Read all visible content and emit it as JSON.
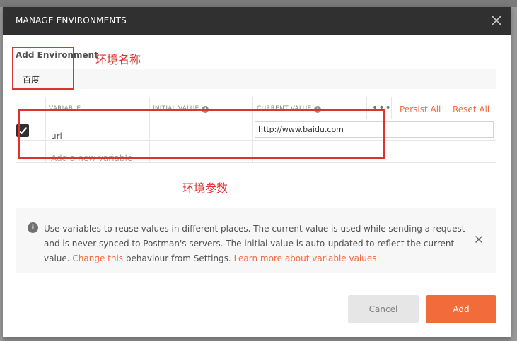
{
  "modal": {
    "title": "MANAGE ENVIRONMENTS",
    "close_icon": "close-icon"
  },
  "form": {
    "label": "Add Environment",
    "name_value": "百度"
  },
  "table": {
    "headers": {
      "variable": "VARIABLE",
      "initial_value": "INITIAL VALUE",
      "current_value": "CURRENT VALUE",
      "info_glyph": "i",
      "more_glyph": "•••"
    },
    "actions": {
      "persist_all": "Persist All",
      "reset_all": "Reset All"
    },
    "rows": [
      {
        "checked": true,
        "variable": "url",
        "initial_value": "",
        "current_value": "http://www.baidu.com"
      }
    ],
    "add_placeholder": "Add a new variable"
  },
  "info": {
    "icon_glyph": "i",
    "text_part1": "Use variables to reuse values in different places. The current value is used while sending a request and is never synced to Postman's servers. The initial value is auto-updated to reflect the current value. ",
    "link_change": "Change this",
    "text_part2": " behaviour from Settings. ",
    "link_learn": "Learn more about variable values"
  },
  "buttons": {
    "cancel": "Cancel",
    "add": "Add"
  },
  "annotations": {
    "env_name": "环境名称",
    "env_params": "环境参数"
  },
  "colors": {
    "accent": "#f26b3a",
    "header_bg": "#303030",
    "annotation": "#e03030"
  }
}
